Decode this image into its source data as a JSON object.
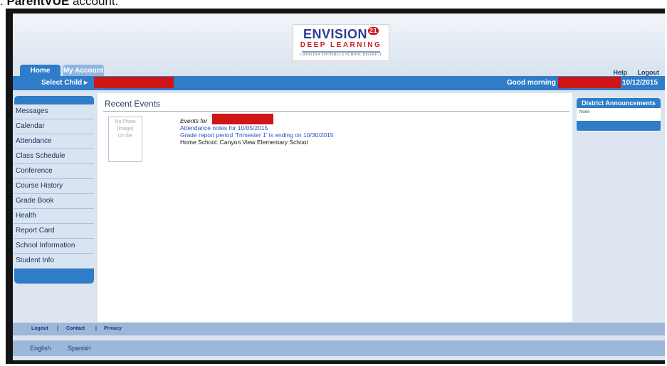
{
  "caption": {
    "prefix": ": ",
    "bold": "ParentVUE",
    "suffix": " account."
  },
  "logo": {
    "title": "ENVISION",
    "badge": "21",
    "subtitle": "DEEP LEARNING",
    "district": "CATALINA FOOTHILLS SCHOOL DISTRICT"
  },
  "tabs": [
    {
      "label": "Home"
    },
    {
      "label": "My Account"
    }
  ],
  "top_links": {
    "help": "Help",
    "logout": "Logout"
  },
  "bluebar": {
    "select_child": "Select Child ▸",
    "greeting": "Good morning",
    "date": "10/12/2015"
  },
  "sidebar": {
    "items": [
      "Messages",
      "Calendar",
      "Attendance",
      "Class Schedule",
      "Conference",
      "Course History",
      "Grade Book",
      "Health",
      "Report Card",
      "School Information",
      "Student Info"
    ]
  },
  "main": {
    "title": "Recent Events",
    "photo": {
      "line1": "No Photo",
      "line2": "[image]",
      "line3": "On file"
    },
    "events_for": "Events for",
    "events": [
      {
        "text": "Attendance notes for 10/05/2015"
      },
      {
        "text": "Grade report period 'Trimester 1' is ending on 10/30/2015"
      },
      {
        "text": "Home School: Canyon View Elementary School"
      }
    ]
  },
  "announcements": {
    "title": "District Announcements",
    "body": "None"
  },
  "footer": {
    "logout": "Logout",
    "sep": "|",
    "contact": "Contact",
    "privacy": "Privacy"
  },
  "languages": [
    "English",
    "Spanish"
  ],
  "colors": {
    "primary_blue": "#2f7cc8",
    "redaction": "#d11414",
    "link": "#2552c4"
  }
}
